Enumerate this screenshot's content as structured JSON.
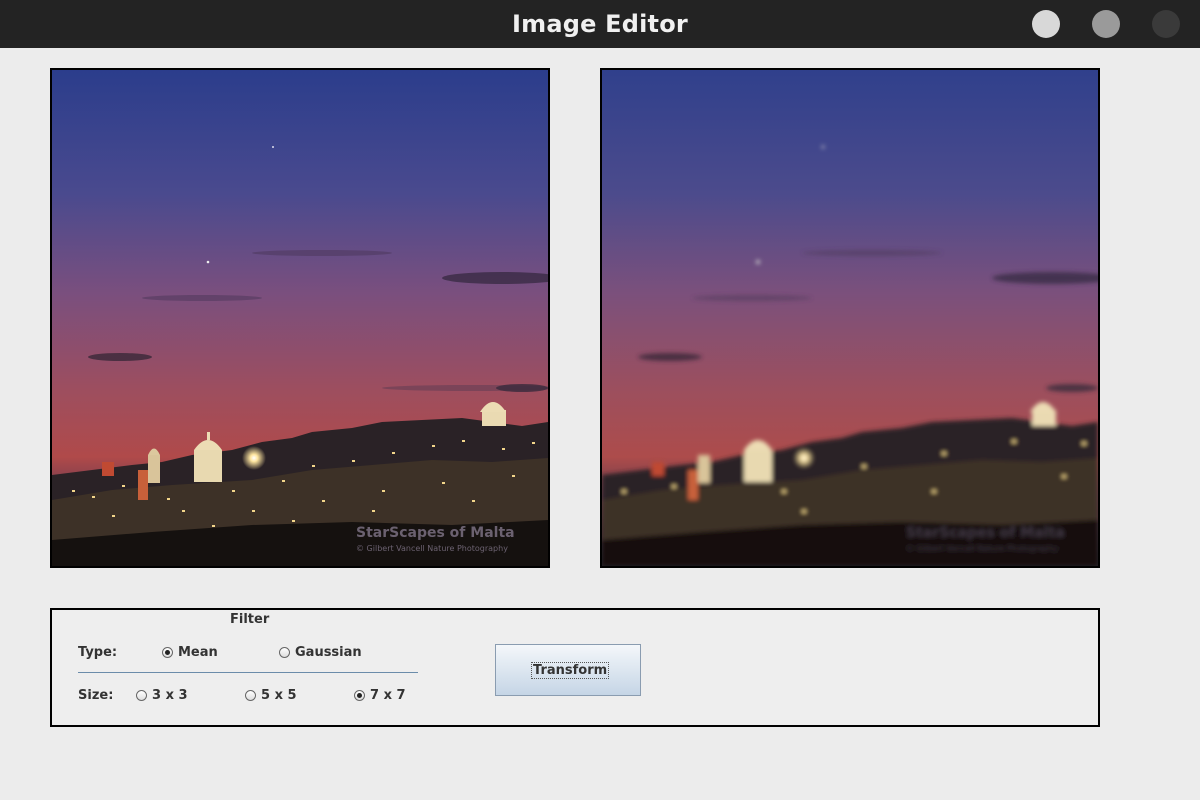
{
  "window": {
    "title": "Image Editor"
  },
  "images": {
    "original": {
      "watermark_title": "StarScapes of Malta",
      "watermark_credit": "© Gilbert Vancell Nature Photography"
    },
    "filtered": {
      "watermark_title": "StarScapes of Malta",
      "watermark_credit": "© Gilbert Vancell Nature Photography"
    }
  },
  "filter_panel": {
    "title": "Filter",
    "type_label": "Type:",
    "type_options": [
      {
        "label": "Mean",
        "selected": true
      },
      {
        "label": "Gaussian",
        "selected": false
      }
    ],
    "size_label": "Size:",
    "size_options": [
      {
        "label": "3 x 3",
        "selected": false
      },
      {
        "label": "5 x 5",
        "selected": false
      },
      {
        "label": "7 x 7",
        "selected": true
      }
    ],
    "transform_label": "Transform"
  },
  "colors": {
    "titlebar": "#232323",
    "background": "#ececec",
    "sky_top": "#2e3f8c",
    "sky_horizon": "#b04a4a",
    "city_lights": "#f2d58a"
  }
}
